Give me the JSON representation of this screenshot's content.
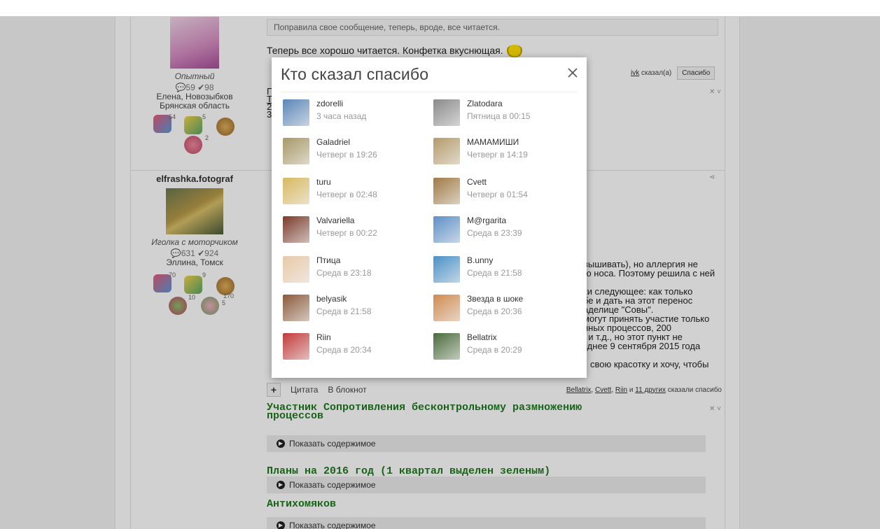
{
  "forum": {
    "post1": {
      "quote": "Поправила свое сообщение, теперь, вроде, все читается.",
      "text": "Теперь все хорошо читается. Конфетка вкуснющая.",
      "thanks_user": "ivk",
      "thanks_said": "сказал(а)",
      "thanks_button": "Спасибо",
      "user_rank": "Опытный",
      "user_stats_comments": "59",
      "user_stats_thanks": "98",
      "user_location_line1": "Елена, Новозыбков",
      "user_location_line2": "Брянская область",
      "awards": [
        "54",
        "5",
        "2"
      ],
      "side_fragments": [
        "П",
        "Т",
        "2",
        "3"
      ]
    },
    "post2": {
      "username": "elfrashka.fotograf",
      "user_rank": "Иголка с моторчиком",
      "user_stats_comments": "631",
      "user_stats_thanks": "924",
      "user_location": "Эллина, Томск",
      "awards": [
        "70",
        "9",
        "10",
        "170",
        "5"
      ],
      "text_right_1": "вышивать), но аллергия не",
      "text_right_2": "го носа. Поэтому решила с ней",
      "text_right_3": "ки следующее: как только",
      "text_right_4": "бе и дать на этот перенос",
      "text_right_5": "аделице \"Совы\".",
      "text_right_6": "могут принять участие только",
      "text_right_7": "нных процессов, 200",
      "text_right_8": ", и т.д., но этот пункт не",
      "text_right_9": "зднее 9 сентября 2015 года",
      "text_right_10": "свою красотку и хочу, чтобы",
      "action_quote": "Цитата",
      "action_notebook": "В блокнот",
      "thanked_1": "Bellatrix",
      "thanked_2": "Cvett",
      "thanked_3": "Riin",
      "thanked_and": "и",
      "thanked_more": "11 других",
      "thanked_suffix": "сказали спасибо",
      "heading1_line1": "Участник Сопротивления бесконтрольному размножению",
      "heading1_line2": "процессов",
      "heading2": "Планы на 2016 год (1 квартал выделен зеленым)",
      "heading3": "Антихомяков",
      "spoiler_label": "Показать содержимое"
    }
  },
  "modal": {
    "title": "Кто сказал спасибо",
    "users": [
      {
        "name": "zdorelli",
        "time": "3 часа назад",
        "avatar_color": "#5b86b8"
      },
      {
        "name": "Zlatodara",
        "time": "Пятница в 00:15",
        "avatar_color": "#8a8a8a"
      },
      {
        "name": "Galadriel",
        "time": "Четверг в 19:26",
        "avatar_color": "#a79866"
      },
      {
        "name": "МАМАМИШИ",
        "time": "Четверг в 14:19",
        "avatar_color": "#b59a6a"
      },
      {
        "name": "turu",
        "time": "Четверг в 02:48",
        "avatar_color": "#d9b860"
      },
      {
        "name": "Cvett",
        "time": "Четверг в 01:54",
        "avatar_color": "#a07a45"
      },
      {
        "name": "Valvariella",
        "time": "Четверг в 00:22",
        "avatar_color": "#7a3b2a"
      },
      {
        "name": "M@rgarita",
        "time": "Среда в 23:39",
        "avatar_color": "#5d8fc7"
      },
      {
        "name": "Птица",
        "time": "Среда в 23:18",
        "avatar_color": "#e8c9a8"
      },
      {
        "name": "B.unny",
        "time": "Среда в 21:58",
        "avatar_color": "#4a90c8"
      },
      {
        "name": "belyasik",
        "time": "Среда в 21:58",
        "avatar_color": "#8a5a3a"
      },
      {
        "name": "Звезда в шоке",
        "time": "Среда в 20:36",
        "avatar_color": "#d08a50"
      },
      {
        "name": "Riin",
        "time": "Среда в 20:34",
        "avatar_color": "#c23a3a"
      },
      {
        "name": "Bellatrix",
        "time": "Среда в 20:29",
        "avatar_color": "#4a6a3a"
      }
    ]
  }
}
